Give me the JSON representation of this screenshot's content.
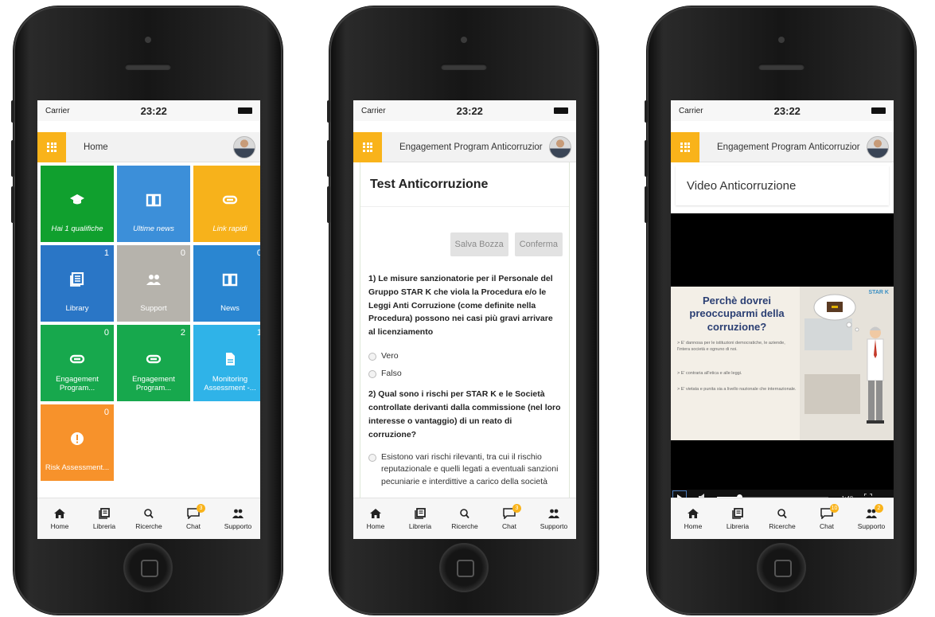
{
  "colors": {
    "accent": "#f9b31a"
  },
  "phones": [
    {
      "status": {
        "carrier": "Carrier",
        "time": "23:22"
      },
      "appbar": {
        "title": "Home"
      },
      "tiles": [
        {
          "label": "Hai 1 qualifiche",
          "count": "",
          "color": "#10a02e",
          "icon": "graduation-cap-icon"
        },
        {
          "label": "Ultime news",
          "count": "",
          "color": "#3c8fd9",
          "icon": "book-icon"
        },
        {
          "label": "Link rapidi",
          "count": "",
          "color": "#f7b21b",
          "icon": "link-icon"
        },
        {
          "label": "Library",
          "count": "1",
          "color": "#2a76c6",
          "icon": "library-icon"
        },
        {
          "label": "Support",
          "count": "0",
          "color": "#b6b3ac",
          "icon": "people-icon"
        },
        {
          "label": "News",
          "count": "0",
          "color": "#2a86d1",
          "icon": "book-icon"
        },
        {
          "label": "Engagement Program...",
          "count": "0",
          "color": "#17a84d",
          "icon": "link-icon"
        },
        {
          "label": "Engagement Program...",
          "count": "2",
          "color": "#17a84d",
          "icon": "link-icon"
        },
        {
          "label": "Monitoring Assessment -...",
          "count": "1",
          "color": "#2fb3e8",
          "icon": "document-icon"
        },
        {
          "label": "Risk Assessment...",
          "count": "0",
          "color": "#f7922b",
          "icon": "alert-icon"
        }
      ],
      "nav": [
        {
          "label": "Home",
          "icon": "home-icon"
        },
        {
          "label": "Libreria",
          "icon": "library-icon"
        },
        {
          "label": "Ricerche",
          "icon": "search-icon"
        },
        {
          "label": "Chat",
          "icon": "chat-icon",
          "badge": "3"
        },
        {
          "label": "Supporto",
          "icon": "support-icon"
        }
      ]
    },
    {
      "status": {
        "carrier": "Carrier",
        "time": "23:22"
      },
      "appbar": {
        "title": "Engagement Program Anticorruzior"
      },
      "test": {
        "title": "Test Anticorruzione",
        "save_label": "Salva Bozza",
        "confirm_label": "Conferma",
        "q1": "1) Le misure sanzionatorie per il Personale del Gruppo STAR K che viola la Procedura e/o le Leggi Anti Corruzione (come definite nella Procedura) possono nei casi più gravi arrivare al licenziamento",
        "q1_opts": [
          "Vero",
          "Falso"
        ],
        "q2": "2) Qual sono i rischi per STAR K e le Società controllate derivanti dalla commissione (nel loro interesse o vantaggio) di un reato di corruzione?",
        "q2_opt": "Esistono vari rischi rilevanti, tra cui il rischio reputazionale e quelli legati a eventuali sanzioni pecuniarie e interdittive a carico della società"
      },
      "nav": [
        {
          "label": "Home",
          "icon": "home-icon"
        },
        {
          "label": "Libreria",
          "icon": "library-icon"
        },
        {
          "label": "Ricerche",
          "icon": "search-icon"
        },
        {
          "label": "Chat",
          "icon": "chat-icon",
          "badge": "3"
        },
        {
          "label": "Supporto",
          "icon": "support-icon"
        }
      ]
    },
    {
      "status": {
        "carrier": "Carrier",
        "time": "23:22"
      },
      "appbar": {
        "title": "Engagement Program Anticorruzior"
      },
      "video": {
        "title": "Video Anticorruzione",
        "slide_title": "Perchè dovrei preoccuparmi della corruzione?",
        "bullets": [
          "> E' dannosa per le istituzioni democratiche, le aziende, l'intera società e ognuno di noi.",
          "> E' contraria all'etica e alle leggi.",
          "> E' vietata e punita sia a livello nazionale che internazionale."
        ],
        "logo": "STAR K",
        "time_remaining": "-1:48",
        "progress": 0.2
      },
      "nav": [
        {
          "label": "Home",
          "icon": "home-icon"
        },
        {
          "label": "Libreria",
          "icon": "library-icon"
        },
        {
          "label": "Ricerche",
          "icon": "search-icon"
        },
        {
          "label": "Chat",
          "icon": "chat-icon",
          "badge": "10"
        },
        {
          "label": "Supporto",
          "icon": "support-icon",
          "badge": "2"
        }
      ]
    }
  ]
}
